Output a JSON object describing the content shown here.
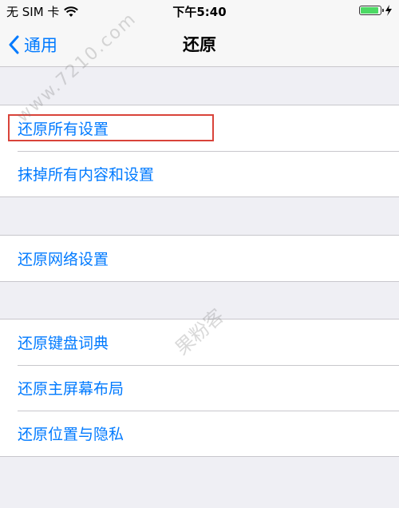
{
  "status_bar": {
    "carrier": "无 SIM 卡",
    "time": "下午5:40",
    "battery_level": 0.85,
    "colors": {
      "battery": "#4cd964"
    }
  },
  "nav": {
    "back_label": "通用",
    "title": "还原",
    "accent_color": "#007aff"
  },
  "groups": [
    {
      "items": [
        {
          "label": "还原所有设置",
          "highlighted": true
        },
        {
          "label": "抹掉所有内容和设置"
        }
      ]
    },
    {
      "items": [
        {
          "label": "还原网络设置"
        }
      ]
    },
    {
      "items": [
        {
          "label": "还原键盘词典"
        },
        {
          "label": "还原主屏幕布局"
        },
        {
          "label": "还原位置与隐私"
        }
      ]
    }
  ],
  "watermarks": {
    "site": "www.7210.com",
    "brand": "果粉客"
  }
}
